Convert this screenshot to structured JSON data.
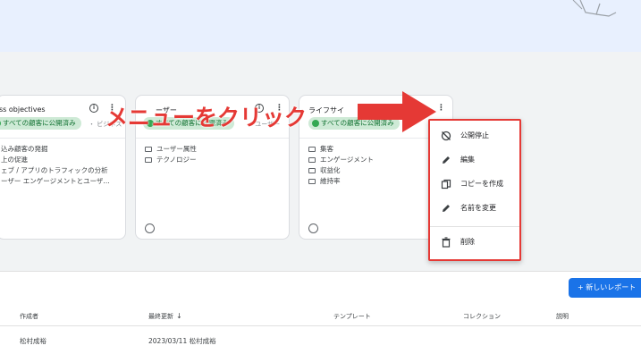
{
  "cards": [
    {
      "title": "ss objectives",
      "chip": "すべての顧客に公開済み",
      "trail": "・ ビジネス",
      "items": [
        "込み顧客の発掘",
        "上の促進",
        "ェブ / アプリのトラフィックの分析",
        "ーザー エンゲージメントとユーザ..."
      ]
    },
    {
      "title": "ーザー",
      "chip": "すべての顧客に公開済み",
      "trail": "・ ユーザー",
      "items": [
        "ユーザー属性",
        "テクノロジー"
      ]
    },
    {
      "title": "ライフサイ",
      "chip": "すべての顧客に公開済み",
      "trail": "",
      "items": [
        "集客",
        "エンゲージメント",
        "収益化",
        "維持率"
      ]
    }
  ],
  "annotation": {
    "text": "メニューをクリック",
    "color": "#e53935"
  },
  "menu": {
    "items": [
      {
        "label": "公開停止",
        "icon": "unpublish-icon"
      },
      {
        "label": "編集",
        "icon": "pencil-icon"
      },
      {
        "label": "コピーを作成",
        "icon": "copy-icon"
      },
      {
        "label": "名前を変更",
        "icon": "pencil-icon"
      },
      {
        "label": "削除",
        "icon": "trash-icon"
      }
    ],
    "border_color": "#e53935"
  },
  "toolbar": {
    "new_report": "+ 新しいレポート"
  },
  "table": {
    "headers": {
      "creator": "作成者",
      "last_modified": "最終更新",
      "template": "テンプレート",
      "collection": "コレクション",
      "description": "説明"
    },
    "rows": [
      {
        "creator": "松村成裕",
        "last_modified": "2023/03/11 松村成裕"
      }
    ]
  },
  "colors": {
    "accent": "#1a73e8",
    "chip_bg": "#ceead6",
    "chip_text": "#137333"
  }
}
